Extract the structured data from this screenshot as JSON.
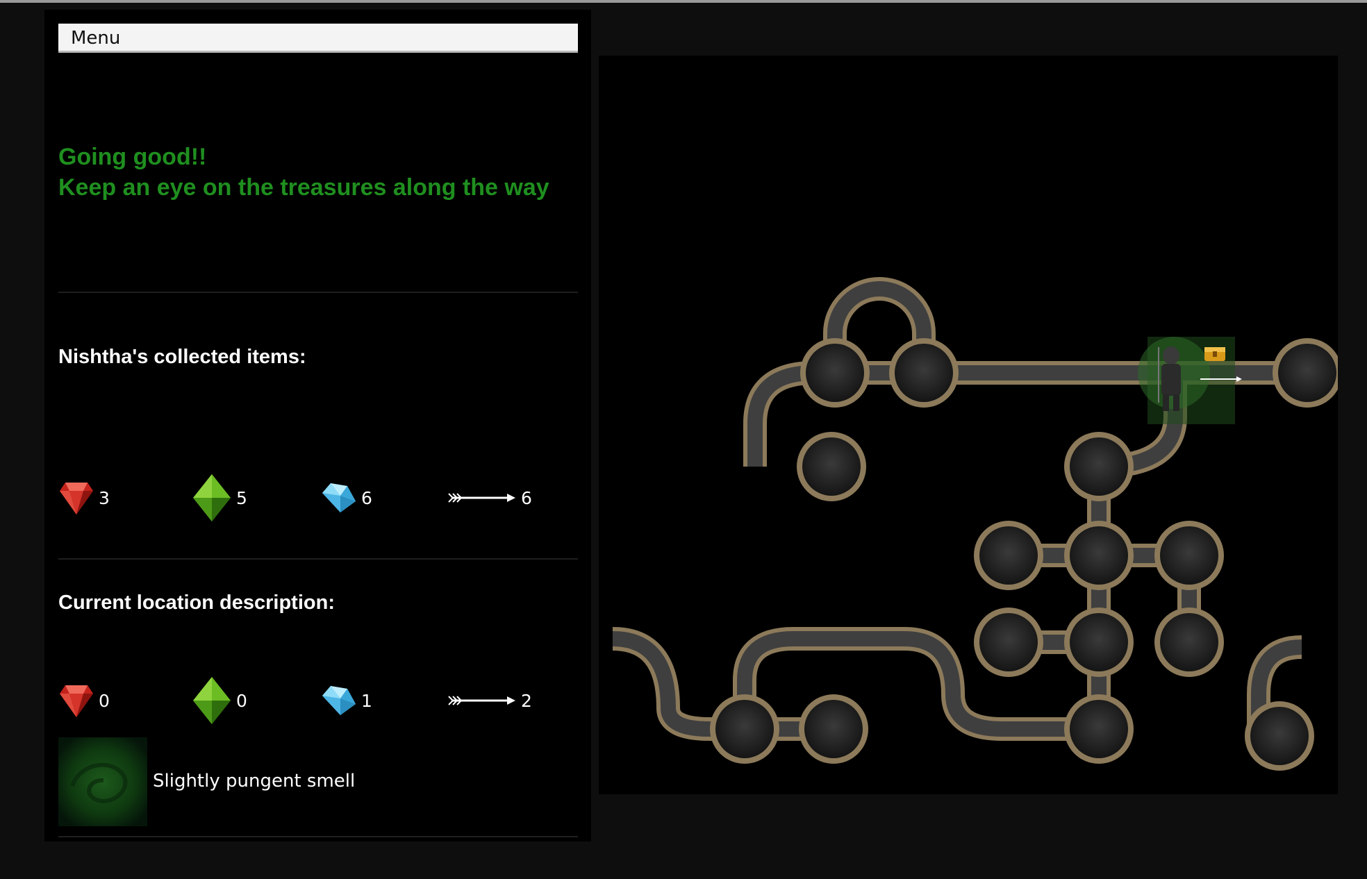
{
  "menu": {
    "label": "Menu"
  },
  "status": {
    "line1": "Going good!!",
    "line2": "Keep an eye on the treasures along the way"
  },
  "collected": {
    "heading": "Nishtha's collected items:",
    "items": [
      {
        "icon": "ruby-icon",
        "color": "#d8342a",
        "count": "3"
      },
      {
        "icon": "emerald-icon",
        "color": "#59a51e",
        "count": "5"
      },
      {
        "icon": "diamond-icon",
        "color": "#5fc3ee",
        "count": "6"
      },
      {
        "icon": "arrow-icon",
        "color": "#ffffff",
        "count": "6"
      }
    ]
  },
  "location": {
    "heading": "Current location description:",
    "items": [
      {
        "icon": "ruby-icon",
        "color": "#d8342a",
        "count": "0"
      },
      {
        "icon": "emerald-icon",
        "color": "#59a51e",
        "count": "0"
      },
      {
        "icon": "diamond-icon",
        "color": "#5fc3ee",
        "count": "1"
      },
      {
        "icon": "arrow-icon",
        "color": "#ffffff",
        "count": "2"
      }
    ],
    "description": "Slightly pungent smell"
  },
  "colors": {
    "status_green": "#1f8f1f",
    "tunnel_floor": "#4a4a4a",
    "tunnel_wall": "#8c7a5a",
    "smell_tile": "#0f3a10"
  }
}
